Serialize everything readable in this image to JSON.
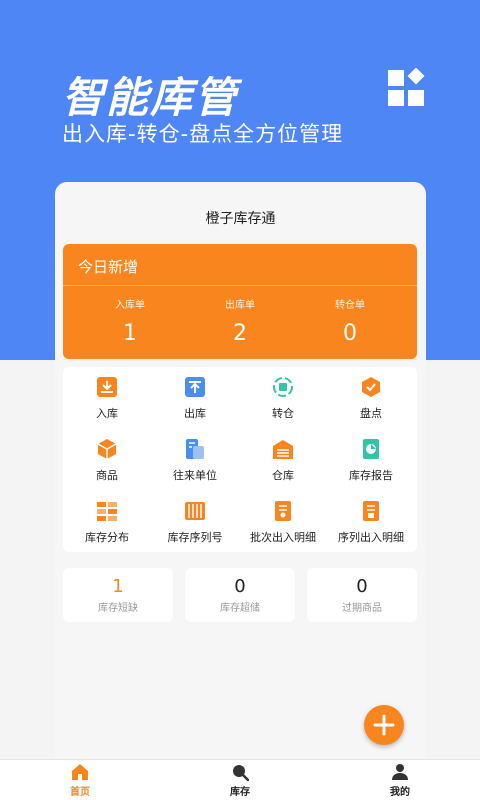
{
  "hero": {
    "title": "智能库管",
    "subtitle": "出入库-转仓-盘点全方位管理",
    "apps_icon": "apps-grid-icon"
  },
  "card": {
    "title": "橙子库存通"
  },
  "today": {
    "title": "今日新增",
    "stats": [
      {
        "label": "入库单",
        "value": "1"
      },
      {
        "label": "出库单",
        "value": "2"
      },
      {
        "label": "转仓单",
        "value": "0"
      }
    ]
  },
  "menu": [
    {
      "label": "入库",
      "icon": "inbound-icon"
    },
    {
      "label": "出库",
      "icon": "outbound-icon"
    },
    {
      "label": "转仓",
      "icon": "transfer-icon"
    },
    {
      "label": "盘点",
      "icon": "stocktake-icon"
    },
    {
      "label": "商品",
      "icon": "product-box-icon"
    },
    {
      "label": "往来单位",
      "icon": "partner-icon"
    },
    {
      "label": "仓库",
      "icon": "warehouse-icon"
    },
    {
      "label": "库存报告",
      "icon": "report-icon"
    },
    {
      "label": "库存分布",
      "icon": "distribution-icon"
    },
    {
      "label": "库存序列号",
      "icon": "serial-icon"
    },
    {
      "label": "批次出入明细",
      "icon": "batch-detail-icon"
    },
    {
      "label": "序列出入明细",
      "icon": "serial-detail-icon"
    }
  ],
  "summary": [
    {
      "value": "1",
      "label": "库存短缺"
    },
    {
      "value": "0",
      "label": "库存超储"
    },
    {
      "value": "0",
      "label": "过期商品"
    }
  ],
  "fab_icon": "plus-icon",
  "tabs": [
    {
      "label": "首页",
      "icon": "home-icon",
      "active": true
    },
    {
      "label": "库存",
      "icon": "search-icon",
      "active": false
    },
    {
      "label": "我的",
      "icon": "user-icon",
      "active": false
    }
  ],
  "colors": {
    "hero": "#4f86f6",
    "accent": "#f9851f",
    "blue": "#4a8ff0",
    "teal": "#33c3a6"
  }
}
